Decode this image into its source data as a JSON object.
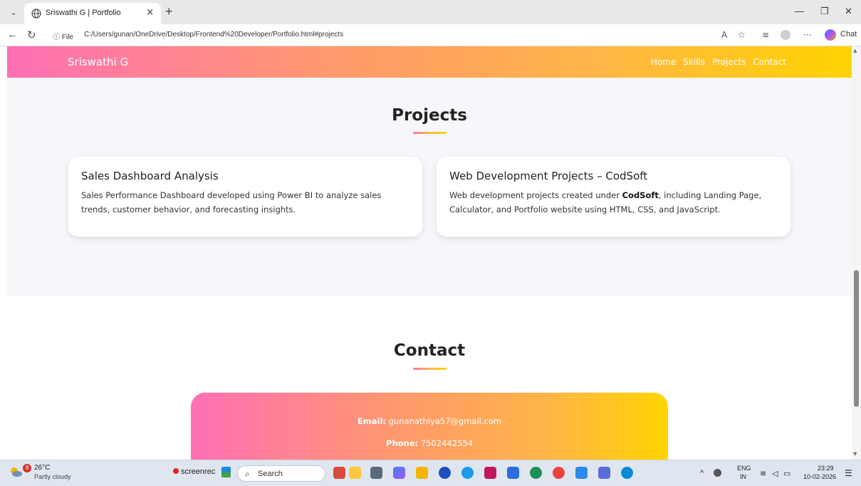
{
  "browser": {
    "tab_title": "Sriswathi G | Portfolio",
    "close_glyph": "×",
    "new_tab_glyph": "+",
    "address_info": "ⓘ File",
    "url": "C:/Users/gunan/OneDrive/Desktop/Frontend%20Developer/Portfolio.html#projects",
    "chat_label": "Chat"
  },
  "site": {
    "brand": "Sriswathi G",
    "nav": [
      "Home",
      "Skills",
      "Projects",
      "Contact"
    ],
    "projects_title": "Projects",
    "projects": [
      {
        "title": "Sales Dashboard Analysis",
        "desc": "Sales Performance Dashboard developed using Power BI to analyze sales trends, customer behavior, and forecasting insights."
      },
      {
        "title": "Web Development Projects – CodSoft",
        "desc_before": "Web development projects created under ",
        "desc_bold": "CodSoft",
        "desc_after": ", including Landing Page, Calculator, and Portfolio website using HTML, CSS, and JavaScript."
      }
    ],
    "contact_title": "Contact",
    "contact": {
      "email_label": "Email:",
      "email": "gunanathiya57@gmail.com",
      "phone_label": "Phone:",
      "phone": "7502442554"
    }
  },
  "taskbar": {
    "weather_badge": "8",
    "temperature": "26°C",
    "condition": "Partly cloudy",
    "screenrec_label": "screenrec",
    "search_placeholder": "Search",
    "lang": "ENG",
    "region": "IN",
    "time": "23:29",
    "date": "10-02-2026"
  },
  "colors": {
    "gradient_pink": "#ff6fb5",
    "gradient_orange": "#ffb547",
    "gradient_yellow": "#ffd400",
    "section_bg": "#f6f7fb"
  }
}
